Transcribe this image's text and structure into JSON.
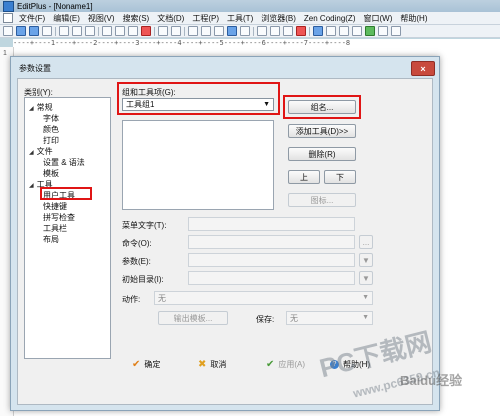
{
  "window": {
    "title": "EditPlus - [Noname1]"
  },
  "menu": [
    "文件(F)",
    "编辑(E)",
    "视图(V)",
    "搜索(S)",
    "文档(D)",
    "工程(P)",
    "工具(T)",
    "浏览器(B)",
    "Zen Coding(Z)",
    "窗口(W)",
    "帮助(H)"
  ],
  "ruler": {
    "text": "----+----1----+----2----+----3----+----4----+----5----+----6----+----7----+----8",
    "marks": [
      "1",
      "2",
      "3",
      "4",
      "5",
      "6",
      "7",
      "8"
    ]
  },
  "editor": {
    "line_number": "1"
  },
  "dialog": {
    "title": "参数设置",
    "close_label": "×",
    "category_label": "类别(Y):",
    "tree": [
      {
        "label": "常规",
        "level": 0,
        "expanded": true
      },
      {
        "label": "字体",
        "level": 1
      },
      {
        "label": "颜色",
        "level": 1
      },
      {
        "label": "打印",
        "level": 1
      },
      {
        "label": "文件",
        "level": 0,
        "expanded": true
      },
      {
        "label": "设置 & 语法",
        "level": 1
      },
      {
        "label": "模板",
        "level": 1
      },
      {
        "label": "工具",
        "level": 0,
        "expanded": true
      },
      {
        "label": "用户工具",
        "level": 1,
        "highlighted": true
      },
      {
        "label": "快捷键",
        "level": 1
      },
      {
        "label": "拼写检查",
        "level": 1
      },
      {
        "label": "工具栏",
        "level": 1
      },
      {
        "label": "布局",
        "level": 1
      }
    ],
    "group_label": "组和工具项(G):",
    "group_value": "工具组1",
    "buttons": {
      "group_name": "组名...",
      "add_tool": "添加工具(D)>>",
      "delete": "删除(R)",
      "up": "上",
      "down": "下",
      "icon": "图标..."
    },
    "fields": {
      "menu_text": "菜单文字(T):",
      "command": "命令(O):",
      "params": "参数(E):",
      "init_dir": "初始目录(I):",
      "browse": "...",
      "action": "动作:",
      "action_value": "无",
      "output_pattern": "输出模板...",
      "save": "保存:",
      "save_value": "无"
    },
    "footer": {
      "ok": "确定",
      "cancel": "取消",
      "apply": "应用(A)",
      "help": "帮助(H)"
    }
  },
  "colors": {
    "highlight": "#e01515",
    "dialog_bg": "#d5e4ee",
    "panel_bg": "#f0f0f0"
  },
  "watermark": {
    "site": "PC下载网",
    "url": "www.pc6359.cn",
    "baidu": "Baidu经验"
  }
}
